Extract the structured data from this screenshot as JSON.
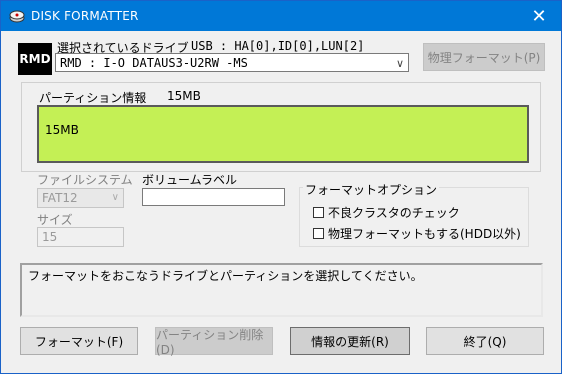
{
  "window": {
    "title": "DISK FORMATTER",
    "close_glyph": "✕"
  },
  "drive": {
    "logo": "RMD",
    "label": "選択されているドライブ",
    "usb_info": "USB : HA[0],ID[0],LUN[2]",
    "selected": "RMD : I-O DATAUS3-U2RW  -MS",
    "physical_format_button": "物理フォーマット(P)"
  },
  "partition": {
    "label": "パーティション情報",
    "size": "15MB",
    "bar_text": "15MB",
    "bar_color": "#c4f055"
  },
  "filesystem": {
    "label": "ファイルシステム",
    "value": "FAT12"
  },
  "volume": {
    "label": "ボリュームラベル",
    "value": ""
  },
  "size": {
    "label": "サイズ",
    "value": "15"
  },
  "format_options": {
    "label": "フォーマットオプション",
    "bad_cluster_check": {
      "label": "不良クラスタのチェック",
      "checked": false
    },
    "physical_format_also": {
      "label": "物理フォーマットもする(HDD以外)",
      "checked": false
    }
  },
  "message": "フォーマットをおこなうドライブとパーティションを選択してください。",
  "buttons": {
    "format": "フォーマット(F)",
    "delete_partition": "パーティション削除(D)",
    "refresh": "情報の更新(R)",
    "exit": "終了(Q)"
  }
}
